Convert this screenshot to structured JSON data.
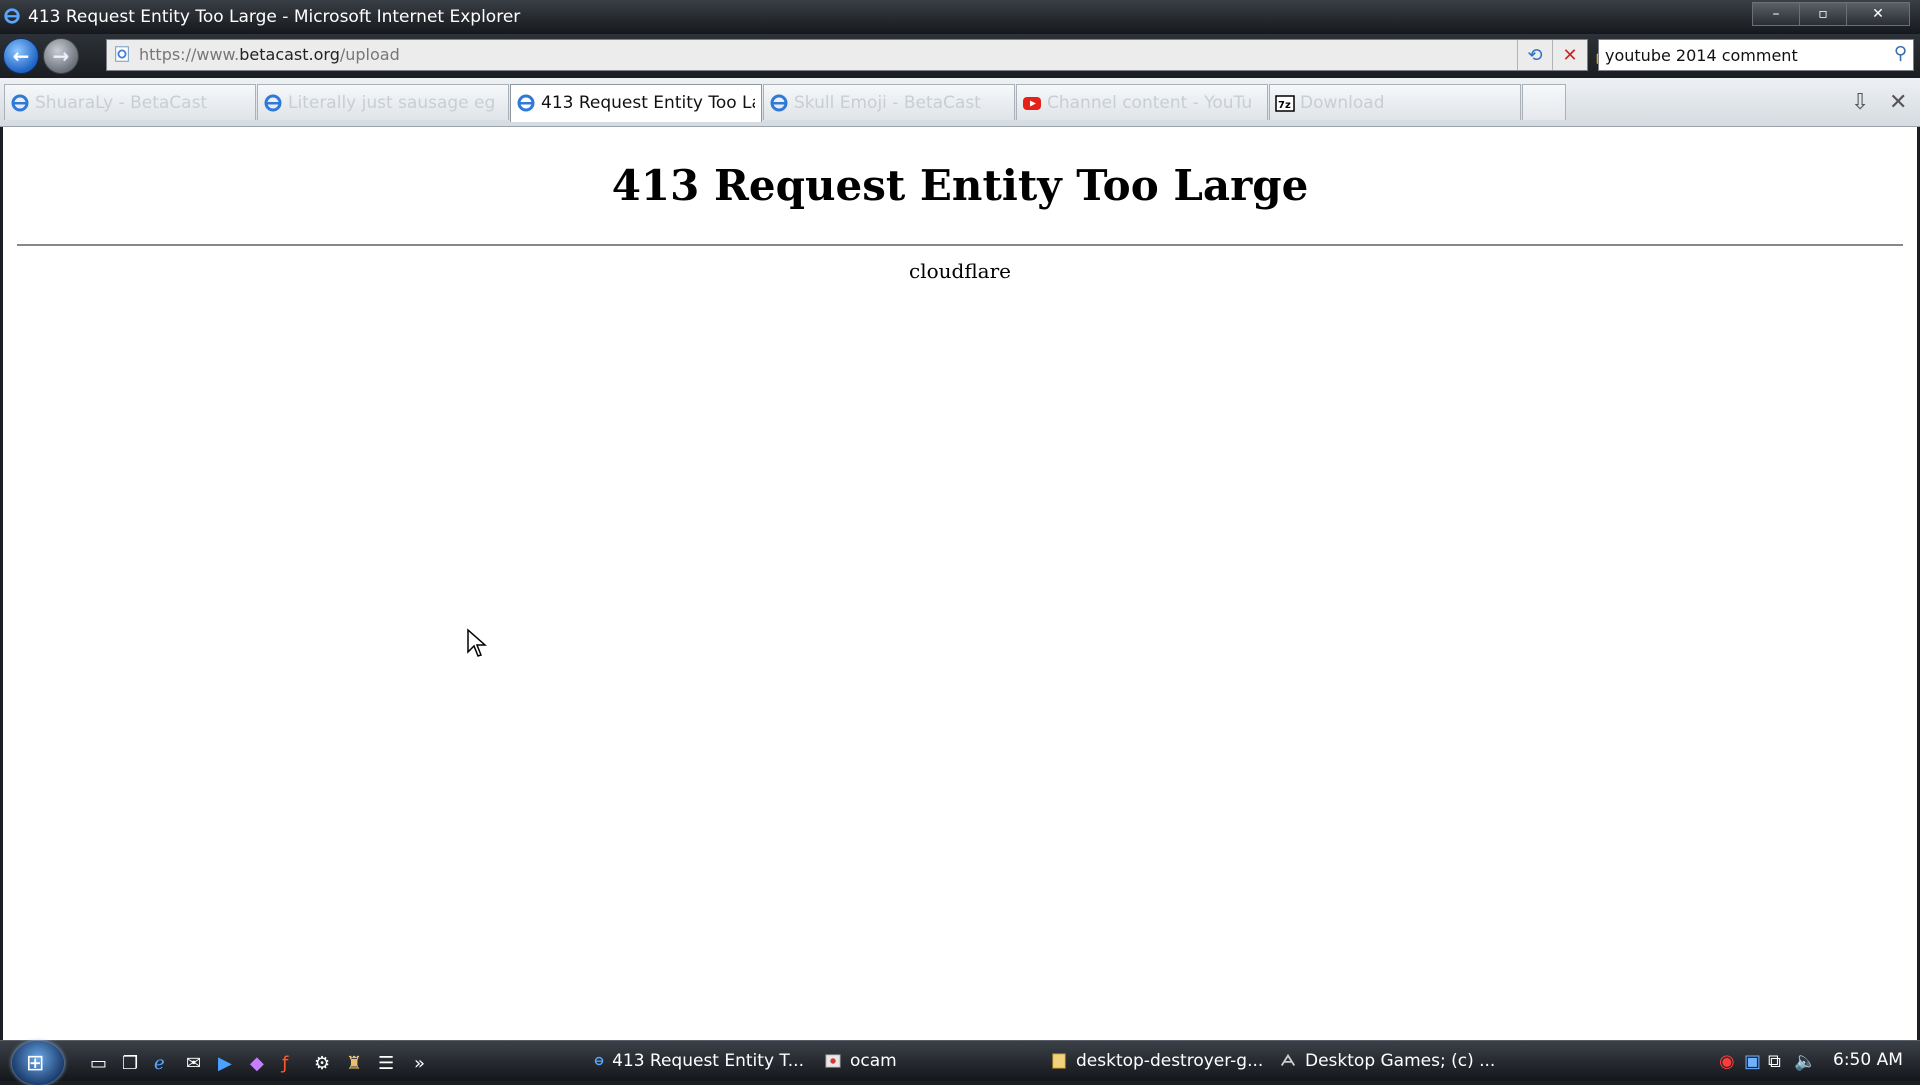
{
  "window": {
    "title": "413 Request Entity Too Large - Microsoft Internet Explorer",
    "buttons": [
      "–",
      "▫",
      "✕"
    ]
  },
  "addressbar": {
    "url_prefix": "https://www.",
    "url_domain": "betacast.org",
    "url_path": "/upload",
    "search_value": "youtube 2014 comment"
  },
  "tabs": [
    {
      "label": "ShuaraLy - BetaCast",
      "icon": "ie-icon",
      "active": false
    },
    {
      "label": "Literally just sausage eg",
      "icon": "ie-icon",
      "active": false
    },
    {
      "label": "413 Request Entity Too La",
      "icon": "ie-icon",
      "active": true
    },
    {
      "label": "Skull Emoji - BetaCast",
      "icon": "ie-icon",
      "active": false
    },
    {
      "label": "Channel content - YouTu",
      "icon": "youtube-icon",
      "active": false
    },
    {
      "label": "Download",
      "icon": "7zip-icon",
      "active": false
    }
  ],
  "page": {
    "heading": "413 Request Entity Too Large",
    "server": "cloudflare"
  },
  "taskbar": {
    "tasks": [
      {
        "label": "413 Request Entity T...",
        "icon": "ie-icon"
      },
      {
        "label": "ocam",
        "icon": "ocam-icon"
      },
      {
        "label": "desktop-destroyer-g...",
        "icon": "folder-icon"
      },
      {
        "label": "Desktop Games;  (c) ...",
        "icon": "game-icon"
      }
    ],
    "clock": "6:50 AM"
  },
  "colors": {
    "ie_blue": "#1f64c4",
    "youtube_red": "#e62117",
    "tab_inactive_text": "#c9ced3"
  }
}
